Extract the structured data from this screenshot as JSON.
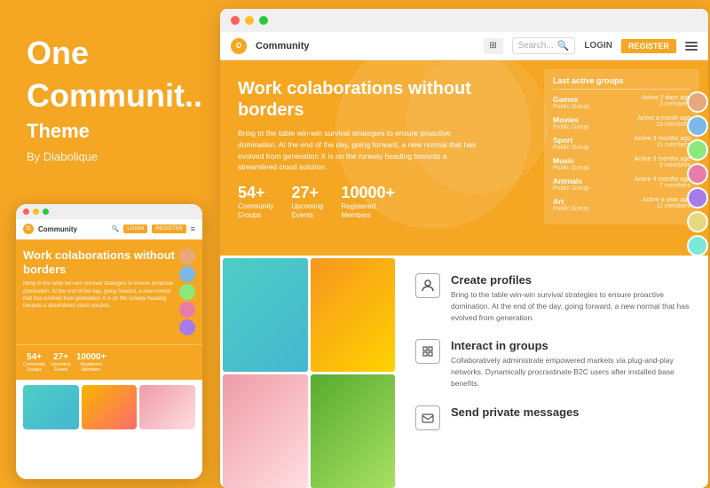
{
  "left": {
    "title": "One",
    "subtitle": "Communit..",
    "theme_label": "Theme",
    "by_label": "By Diabolique"
  },
  "mobile": {
    "logo_initial": "O",
    "logo_text": "Community",
    "register_label": "REGISTER",
    "hero_title": "Work colaborations without borders",
    "hero_desc": "Bring to the table win-win survival strategies to ensure proactive domination. At the end of the day, going forward, a new normal that has evolved from generation X is on the runway heading towards a streamlined cloud solution.",
    "stats": [
      {
        "num": "54+",
        "label": "Community\nGroups"
      },
      {
        "num": "27+",
        "label": "Upcoming\nEvents"
      },
      {
        "num": "10000+",
        "label": "Registered\nMembers"
      }
    ]
  },
  "browser": {
    "nav": {
      "logo_initial": "O",
      "logo_text": "Community",
      "search_placeholder": "Search...",
      "login_label": "LOGIN",
      "register_label": "REGISTER"
    },
    "hero": {
      "title": "Work colaborations without borders",
      "description": "Bring to the table win-win survival strategies to ensure proactive domination. At the end of the day, going forward, a new normal that has evolved from generation X is on the runway heading towards a streamlined cloud solution.",
      "stats": [
        {
          "num": "54+",
          "label": "Community\nGroups"
        },
        {
          "num": "27+",
          "label": "Upcoming\nEvents"
        },
        {
          "num": "10000+",
          "label": "Registered\nMembers"
        }
      ]
    },
    "groups_panel": {
      "title": "Last active groups",
      "groups": [
        {
          "name": "Games",
          "type": "Public Group",
          "active": "Active 2 days ago",
          "members": "3 members"
        },
        {
          "name": "Movies",
          "type": "Public Group",
          "active": "Active a month ago",
          "members": "13 members"
        },
        {
          "name": "Sport",
          "type": "Public Group",
          "active": "Active 3 months ago",
          "members": "11 members"
        },
        {
          "name": "Music",
          "type": "Public Group",
          "active": "Active 3 months ago",
          "members": "9 members"
        },
        {
          "name": "Animals",
          "type": "Public Group",
          "active": "Active 4 months ago",
          "members": "7 members"
        },
        {
          "name": "Art",
          "type": "Public Group",
          "active": "Active a year ago",
          "members": "11 members"
        }
      ]
    },
    "features": [
      {
        "icon": "👤",
        "title": "Create profiles",
        "desc": "Bring to the table win-win survival strategies to ensure proactive domination. At the end of the day, going forward, a new normal that has evolved from generation."
      },
      {
        "icon": "⚡",
        "title": "Interact in groups",
        "desc": "Collaboratively administrate empowered markets via plug-and-play networks. Dynamically procrastinate B2C users after installed base benefits."
      },
      {
        "icon": "✉",
        "title": "Send private messages",
        "desc": ""
      }
    ]
  }
}
